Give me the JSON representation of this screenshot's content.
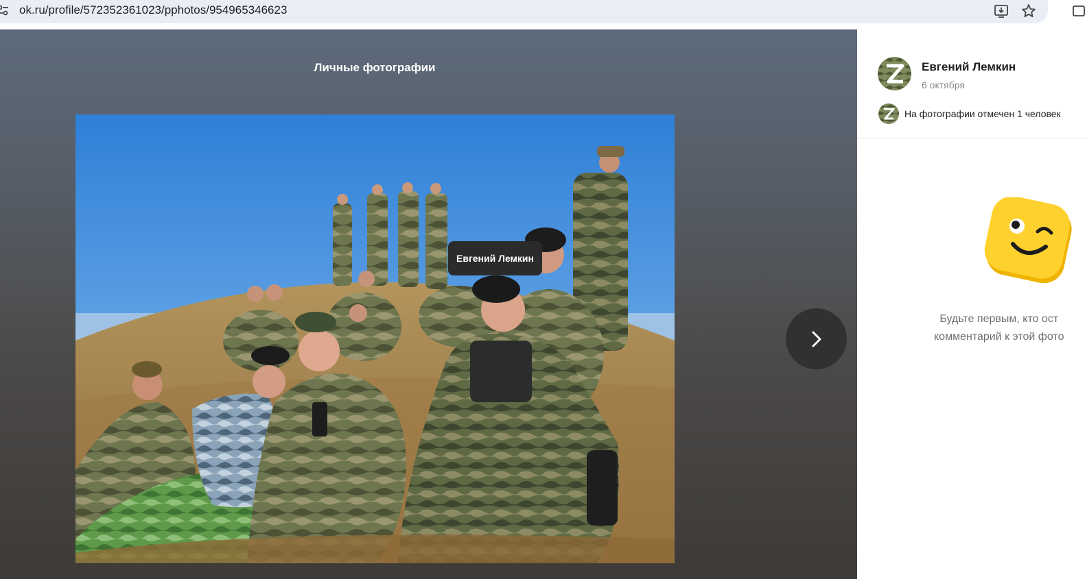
{
  "browser": {
    "url": "ok.ru/profile/572352361023/pphotos/954965346623",
    "icons": [
      "site-info-icon",
      "install-app-icon",
      "bookmark-star-icon",
      "extensions-icon"
    ]
  },
  "viewer": {
    "album_title": "Личные фотографии",
    "photo_tag": "Евгений Лемкин",
    "next_icon": "chevron-right-icon"
  },
  "panel": {
    "author_name": "Евгений Лемкин",
    "date": "6 октября",
    "tagged_text": "На фотографии отмечен 1 человек",
    "empty_line1": "Будьте первым, кто ост",
    "empty_line2": "комментарий к этой фото"
  },
  "colors": {
    "accent": "#ffcc33",
    "dark_button": "#2f3133"
  }
}
